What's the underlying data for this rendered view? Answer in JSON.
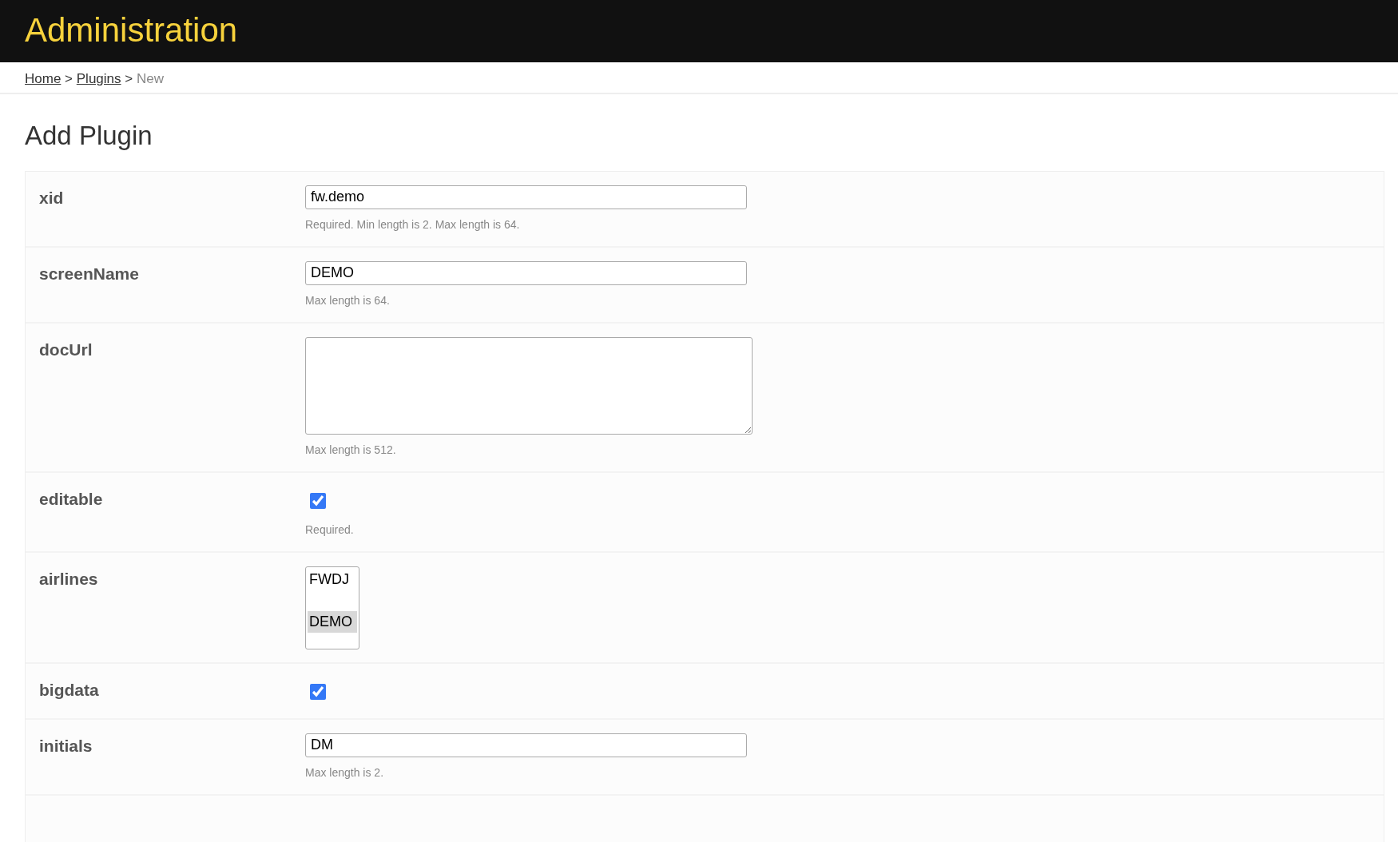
{
  "header": {
    "title": "Administration"
  },
  "breadcrumb": {
    "links": [
      "Home",
      "Plugins"
    ],
    "current": "New",
    "separators": [
      ">",
      ">"
    ]
  },
  "page_title": "Add Plugin",
  "fields": [
    {
      "label": "xid",
      "kind": "text",
      "value": "fw.demo",
      "hint": "Required. Min length is 2. Max length is 64."
    },
    {
      "label": "screenName",
      "kind": "text",
      "value": "DEMO",
      "hint": "Max length is 64."
    },
    {
      "label": "docUrl",
      "kind": "textarea",
      "hint": "Max length is 512."
    },
    {
      "label": "editable",
      "kind": "checkbox",
      "checked": true,
      "hint": "Required."
    },
    {
      "label": "airlines",
      "kind": "multiselect",
      "options": [
        {
          "label": "FWDJ",
          "selected": false
        },
        {
          "label": "DEMO",
          "selected": true
        }
      ]
    },
    {
      "label": "bigdata",
      "kind": "checkbox",
      "checked": true
    },
    {
      "label": "initials",
      "kind": "text",
      "value": "DM",
      "hint": "Max length is 2."
    }
  ]
}
